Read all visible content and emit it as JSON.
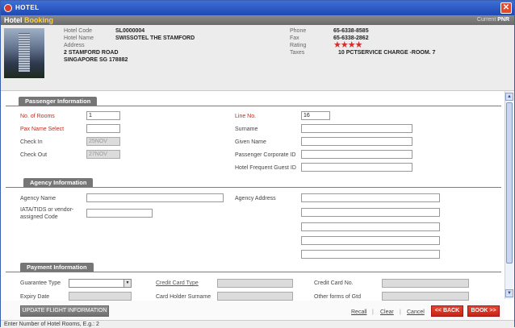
{
  "window": {
    "title": "HOTEL"
  },
  "header": {
    "title_part1": "Hotel",
    "title_part2": "Booking",
    "current_label": "Current",
    "current_value": "PNR"
  },
  "hotel": {
    "code_label": "Hotel Code",
    "code_value": "SL0000004",
    "name_label": "Hotel Name",
    "name_value": "SWISSOTEL THE STAMFORD",
    "address_label": "Address",
    "address_line1": "2 STAMFORD ROAD",
    "address_line2": "SINGAPORE SG 178882",
    "phone_label": "Phone",
    "phone_value": "65-6338-8585",
    "fax_label": "Fax",
    "fax_value": "65-6338-2862",
    "rating_label": "Rating",
    "rating_value": "★★★★",
    "rating_stars": 4,
    "taxes_label": "Taxes",
    "taxes_value": "10 PCTSERVICE CHARGE -ROOM. 7"
  },
  "passenger": {
    "section_title": "Passenger Information",
    "rooms_label": "No. of Rooms",
    "rooms_value": "1",
    "pax_label": "Pax Name Select",
    "pax_value": "",
    "checkin_label": "Check In",
    "checkin_value": "25NOV",
    "checkout_label": "Check Out",
    "checkout_value": "27NOV",
    "line_label": "Line No.",
    "line_value": "16",
    "surname_label": "Surname",
    "surname_value": "",
    "given_label": "Given Name",
    "given_value": "",
    "corp_label": "Passenger Corporate ID",
    "corp_value": "",
    "freq_label": "Hotel Frequent Guest ID",
    "freq_value": ""
  },
  "agency": {
    "section_title": "Agency Information",
    "name_label": "Agency Name",
    "name_value": "",
    "iata_label_1": "IATA/TIDS or vendor-",
    "iata_label_2": "assigned Code",
    "iata_value": "",
    "address_label": "Agency Address",
    "address_lines": [
      "",
      "",
      "",
      "",
      ""
    ]
  },
  "payment": {
    "section_title": "Payment Information",
    "guarantee_label": "Guarantee Type",
    "guarantee_value": "",
    "cctype_label": "Credit Card Type",
    "cctype_value": "",
    "ccno_label": "Credit Card No.",
    "ccno_value": "",
    "expiry_label": "Expiry Date",
    "expiry_value": "",
    "holder_label": "Card Holder Surname",
    "holder_value": "",
    "other_label": "Other forms of Gtd",
    "other_value": ""
  },
  "actions": {
    "update_label": "UPDATE FLIGHT INFORMATION",
    "recall_label": "Recall",
    "clear_label": "Clear",
    "cancel_label": "Cancel",
    "separator": "|",
    "back_label": "<< BACK",
    "book_label": "BOOK >>"
  },
  "status": {
    "text": "Enter Number of Hotel Rooms, E.g.: 2"
  },
  "colors": {
    "title_bar": "#2a55c2",
    "section_gray": "#767676",
    "accent_red": "#c42a1c"
  }
}
